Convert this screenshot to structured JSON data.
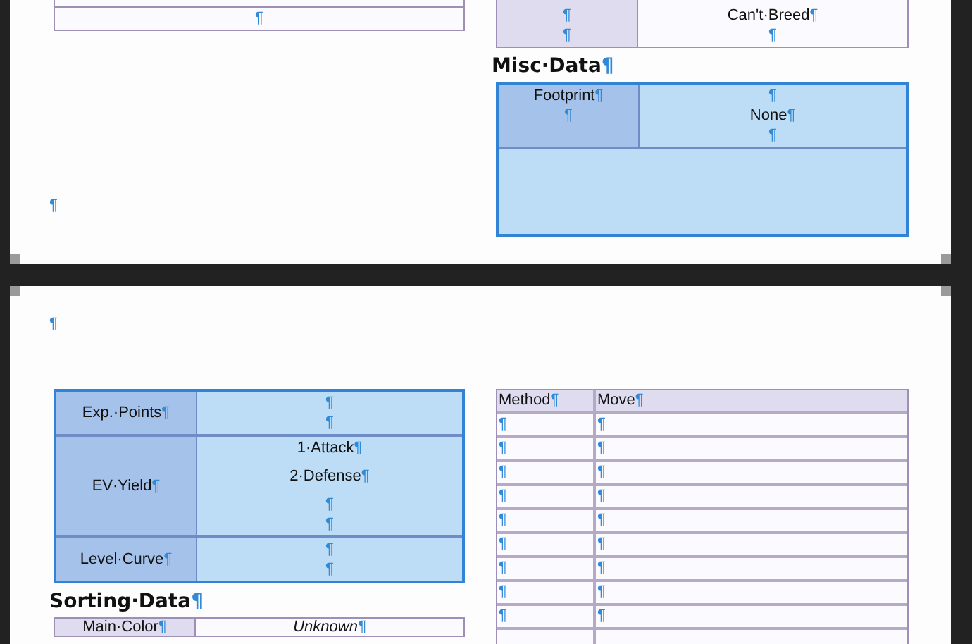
{
  "page_1": {
    "left_table": {
      "rows": [
        {
          "cells": [
            {
              "kind": "value",
              "merged": true,
              "paragraphs": [
                "¶"
              ]
            }
          ]
        }
      ]
    },
    "left_paragraphs": [
      "¶"
    ],
    "breeding_table": {
      "rows": [
        {
          "cells": [
            {
              "kind": "header",
              "merged": false,
              "paragraphs": [
                "¶",
                "¶"
              ]
            },
            {
              "kind": "value",
              "merged": false,
              "paragraphs": [
                "Can't·Breed¶",
                "¶"
              ]
            }
          ]
        }
      ]
    },
    "misc_heading": "Misc·Data¶",
    "misc_table": {
      "rows": [
        {
          "cells": [
            {
              "kind": "header",
              "merged": false,
              "paragraphs": [
                "Footprint¶",
                "¶"
              ]
            },
            {
              "kind": "value",
              "merged": false,
              "paragraphs": [
                "¶",
                "None¶",
                "¶"
              ]
            }
          ]
        },
        {
          "cells": [
            {
              "kind": "blank",
              "merged": true
            }
          ]
        }
      ]
    }
  },
  "page_2": {
    "top_paragraphs": [
      "¶"
    ],
    "stats_table": {
      "rows": [
        {
          "cells": [
            {
              "kind": "header",
              "merged": false,
              "paragraphs": [
                "Exp.·Points¶"
              ]
            },
            {
              "kind": "value",
              "merged": false,
              "paragraphs": [
                "¶",
                "¶"
              ]
            }
          ]
        },
        {
          "cells": [
            {
              "kind": "header",
              "merged": false,
              "paragraphs": [
                "EV·Yield¶"
              ]
            },
            {
              "kind": "value",
              "merged": false,
              "paragraphs": [
                "1·Attack¶",
                "2·Defense¶",
                "¶",
                "¶"
              ]
            }
          ]
        },
        {
          "cells": [
            {
              "kind": "header",
              "merged": false,
              "paragraphs": [
                "Level·Curve¶"
              ]
            },
            {
              "kind": "value",
              "merged": false,
              "paragraphs": [
                "¶",
                "¶"
              ]
            }
          ]
        }
      ]
    },
    "sorting_heading": "Sorting·Data¶",
    "sorting_table": {
      "rows": [
        {
          "cells": [
            {
              "kind": "header",
              "merged": false,
              "paragraphs": [
                "Main·Color¶"
              ]
            },
            {
              "kind": "italic",
              "merged": false,
              "paragraphs": [
                "Unknown¶"
              ]
            }
          ]
        }
      ]
    },
    "moves_table": {
      "columns": [
        "Method¶",
        "Move¶"
      ],
      "rows": [
        [
          "¶",
          "¶"
        ],
        [
          "¶",
          "¶"
        ],
        [
          "¶",
          "¶"
        ],
        [
          "¶",
          "¶"
        ],
        [
          "¶",
          "¶"
        ],
        [
          "¶",
          "¶"
        ],
        [
          "¶",
          "¶"
        ],
        [
          "¶",
          "¶"
        ],
        [
          "¶",
          "¶"
        ]
      ]
    }
  }
}
